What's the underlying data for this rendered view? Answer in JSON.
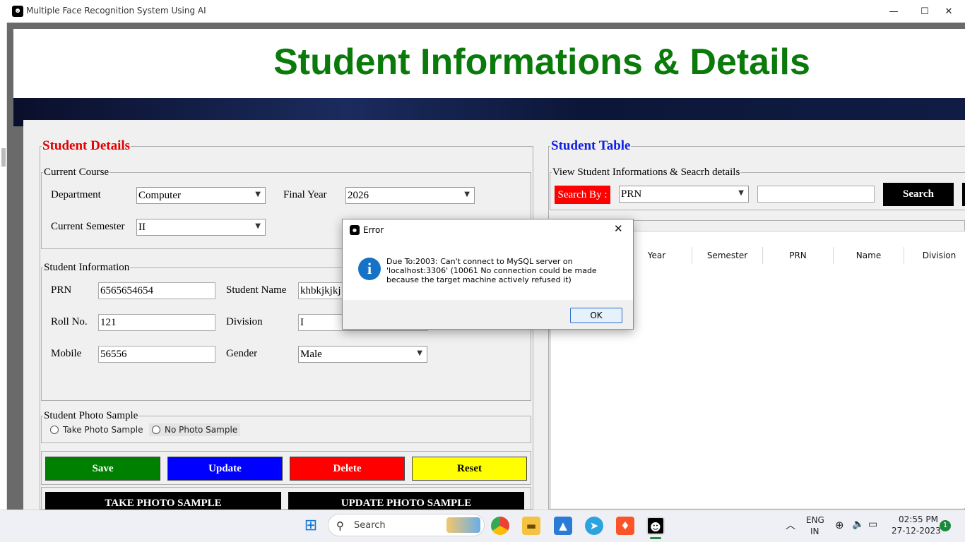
{
  "window": {
    "title": "Multiple Face Recognition System Using AI",
    "minimize_glyph": "—",
    "maximize_glyph": "☐",
    "close_glyph": "✕"
  },
  "header": {
    "title": "Student Informations & Details"
  },
  "student_details": {
    "legend": "Student Details",
    "current_course": {
      "legend": "Current Course",
      "department_label": "Department",
      "department_value": "Computer",
      "final_year_label": "Final Year",
      "final_year_value": "2026",
      "semester_label": "Current Semester",
      "semester_value": "II"
    },
    "student_information": {
      "legend": "Student Information",
      "prn_label": "PRN",
      "prn_value": "6565654654",
      "name_label": "Student Name",
      "name_value": "khbkjkjkj",
      "roll_label": "Roll No.",
      "roll_value": "121",
      "division_label": "Division",
      "division_value": "I",
      "mobile_label": "Mobile",
      "mobile_value": "56556",
      "gender_label": "Gender",
      "gender_value": "Male"
    },
    "photo_sample": {
      "legend": "Student Photo Sample",
      "take_label": "Take Photo Sample",
      "no_label": "No Photo Sample"
    },
    "buttons": {
      "save": "Save",
      "update": "Update",
      "delete": "Delete",
      "reset": "Reset",
      "take_photo": "TAKE PHOTO SAMPLE",
      "update_photo": "UPDATE PHOTO SAMPLE"
    }
  },
  "student_table": {
    "legend": "Student Table",
    "search_legend": "View Student Informations & Seacrh details",
    "search_by_label": "Search By :",
    "search_by_value": "PRN",
    "search_input_value": "",
    "search_button": "Search",
    "columns": [
      "Year",
      "Semester",
      "PRN",
      "Name",
      "Division"
    ],
    "rows": []
  },
  "dialog": {
    "title": "Error",
    "message": "Due To:2003: Can't connect to MySQL server on 'localhost:3306' (10061 No connection could be made because the target machine actively refused it)",
    "ok_label": "OK"
  },
  "taskbar": {
    "search_label": "Search",
    "lang_primary": "ENG",
    "lang_secondary": "IN",
    "time": "02:55 PM",
    "date": "27-12-2023",
    "notification_count": "1"
  },
  "colors": {
    "title_green": "#0a7a0a",
    "legend_red": "#e00000",
    "legend_blue": "#1020e0",
    "save": "#008000",
    "update": "#0000ff",
    "delete": "#ff0000",
    "reset": "#ffff00",
    "dialog_info": "#1672c6"
  }
}
